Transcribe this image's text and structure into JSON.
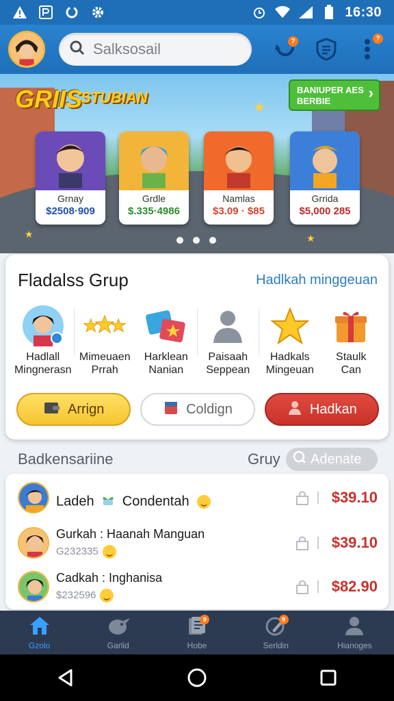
{
  "status_bar": {
    "time": "16:30"
  },
  "header": {
    "search_placeholder": "Salksosail",
    "notif_badge": "?",
    "more_badge": "?"
  },
  "banner": {
    "title": "GRIIS",
    "subtitle": "STUBIAN",
    "cta": "BANIUPER AES BERBIE",
    "cards": [
      {
        "name": "Grnay",
        "price": "$2508·909",
        "price_color": "#1f4fa8",
        "bg": "#6b4bb8"
      },
      {
        "name": "Grdle",
        "price": "$.335·4986",
        "price_color": "#2e8b2e",
        "bg": "#f3b43a"
      },
      {
        "name": "Namlas",
        "price": "$3.09 · $85",
        "price_color": "#d2462d",
        "bg": "#f06a2b"
      },
      {
        "name": "Grrida",
        "price": "$5,000 285",
        "price_color": "#c02a2a",
        "bg": "#3c7fd8"
      }
    ]
  },
  "group_panel": {
    "title": "Fladalss Grup",
    "link": "Hadlkah minggeuan",
    "items": [
      {
        "line1": "Hadlall",
        "line2": "Mingnerasn"
      },
      {
        "line1": "Mimeuaen",
        "line2": "Prrah"
      },
      {
        "line1": "Harklean",
        "line2": "Nanian"
      },
      {
        "line1": "Paisaah",
        "line2": "Seppean"
      },
      {
        "line1": "Hadkals",
        "line2": "Mingeuan"
      },
      {
        "line1": "Staulk",
        "line2": "Can"
      }
    ],
    "buttons": {
      "yellow": "Arrign",
      "white": "Coldign",
      "red": "Hadkan"
    }
  },
  "ranking": {
    "title": "Badkensariine",
    "label": "Gruy",
    "action": "Adenate",
    "rows": [
      {
        "name": "Ladeh",
        "name2": "Condentah",
        "sub": "",
        "amount": "$39.10"
      },
      {
        "name": "Gurkah : Haanah Manguan",
        "name2": "",
        "sub": "G232335",
        "amount": "$39.10"
      },
      {
        "name": "Cadkah : Inghanisa",
        "name2": "",
        "sub": "$232596",
        "amount": "$82.90"
      }
    ]
  },
  "bottom_nav": {
    "items": [
      {
        "label": "Gzolo"
      },
      {
        "label": "Garlid"
      },
      {
        "label": "Hobe",
        "badge": "9"
      },
      {
        "label": "Serldin",
        "badge": "9"
      },
      {
        "label": "Hianoges"
      }
    ]
  },
  "colors": {
    "primary": "#1f6fb8",
    "accent_red": "#c9302c",
    "yellow": "#f6c52f"
  }
}
